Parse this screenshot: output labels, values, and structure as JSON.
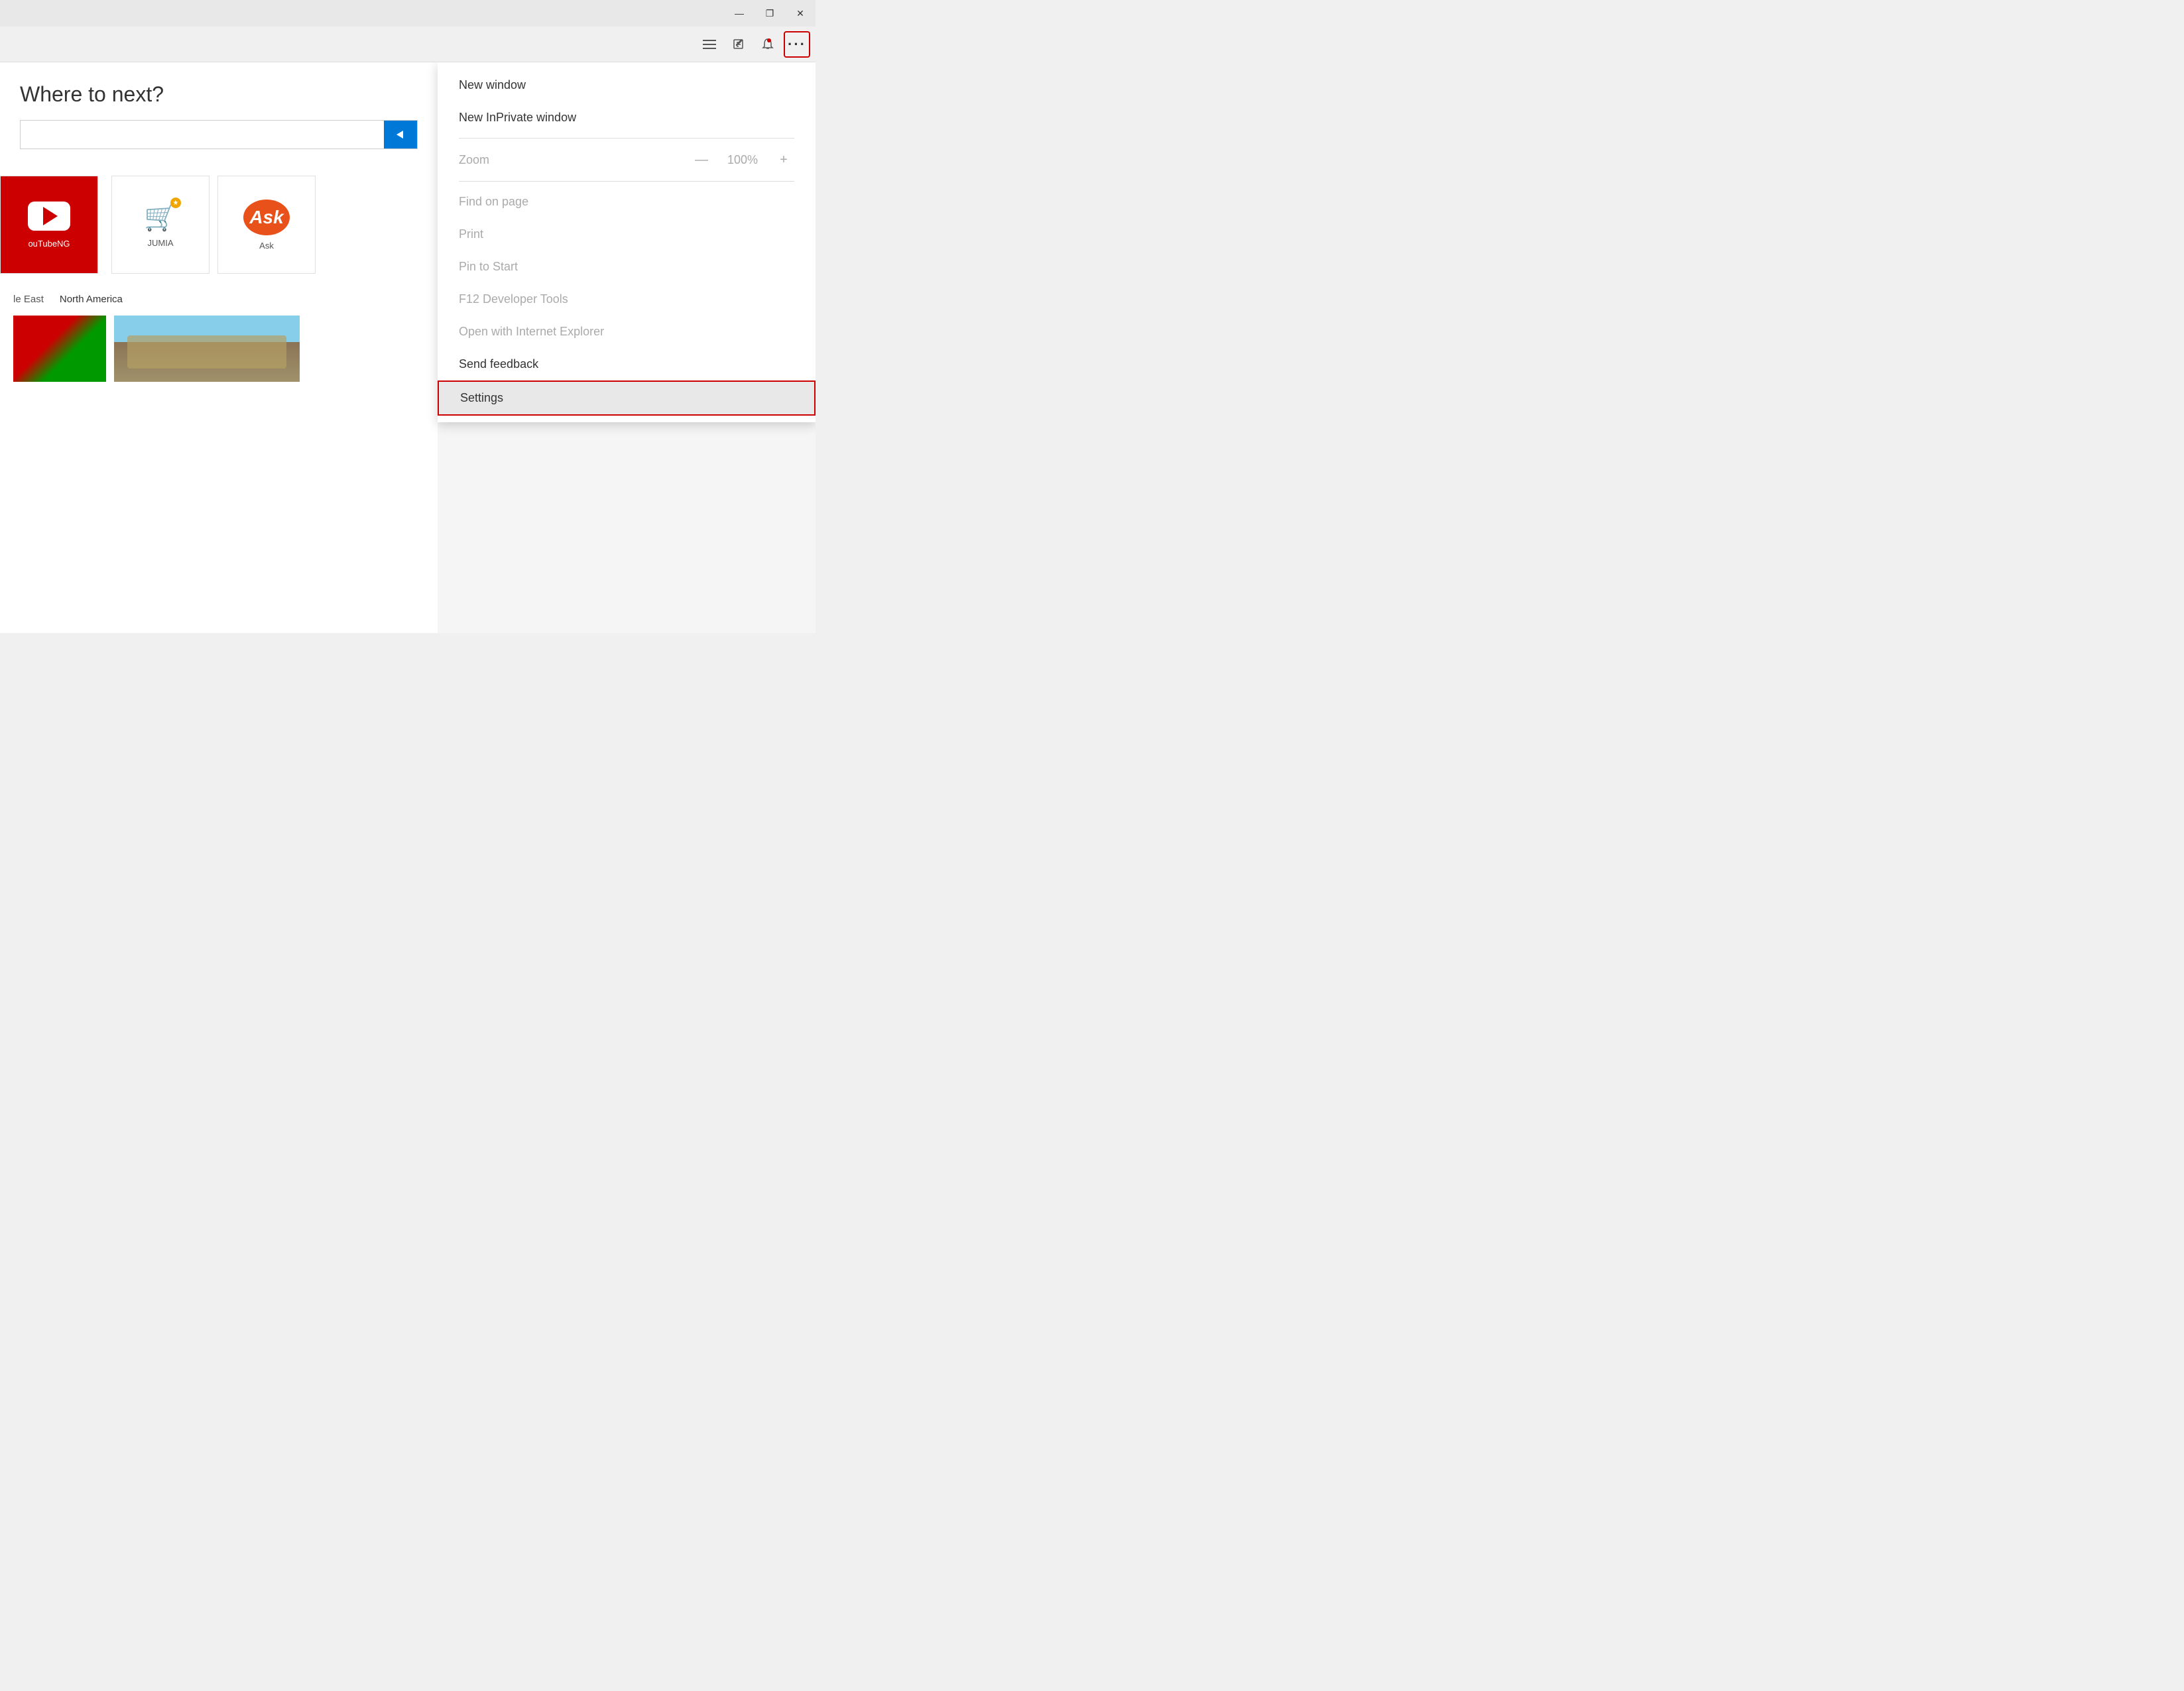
{
  "titlebar": {
    "minimize_label": "—",
    "restore_label": "❐",
    "close_label": "✕"
  },
  "toolbar": {
    "hamburger_icon": "hamburger",
    "edit_icon": "edit",
    "bell_icon": "bell",
    "more_icon": "•••",
    "more_label": "···"
  },
  "page": {
    "title": "Where to next?",
    "search_placeholder": "",
    "search_button": "→"
  },
  "tiles": [
    {
      "id": "youtube",
      "label": "ouTubeNG",
      "type": "youtube"
    },
    {
      "id": "jumia",
      "label": "JUMIA",
      "type": "jumia"
    },
    {
      "id": "ask",
      "label": "Ask",
      "type": "ask"
    }
  ],
  "news": {
    "tabs": [
      "le East",
      "North America"
    ],
    "active_tab": "North America"
  },
  "menu": {
    "items": [
      {
        "id": "new-window",
        "label": "New window",
        "enabled": true
      },
      {
        "id": "new-inprivate",
        "label": "New InPrivate window",
        "enabled": true
      },
      {
        "id": "zoom-label",
        "label": "Zoom",
        "special": "zoom"
      },
      {
        "id": "find-on-page",
        "label": "Find on page",
        "enabled": false
      },
      {
        "id": "print",
        "label": "Print",
        "enabled": false
      },
      {
        "id": "pin-to-start",
        "label": "Pin to Start",
        "enabled": false
      },
      {
        "id": "f12-dev-tools",
        "label": "F12 Developer Tools",
        "enabled": false
      },
      {
        "id": "open-ie",
        "label": "Open with Internet Explorer",
        "enabled": false
      },
      {
        "id": "send-feedback",
        "label": "Send feedback",
        "enabled": true
      },
      {
        "id": "settings",
        "label": "Settings",
        "enabled": true,
        "highlighted": true
      }
    ],
    "zoom_minus": "—",
    "zoom_value": "100%",
    "zoom_plus": "+"
  }
}
